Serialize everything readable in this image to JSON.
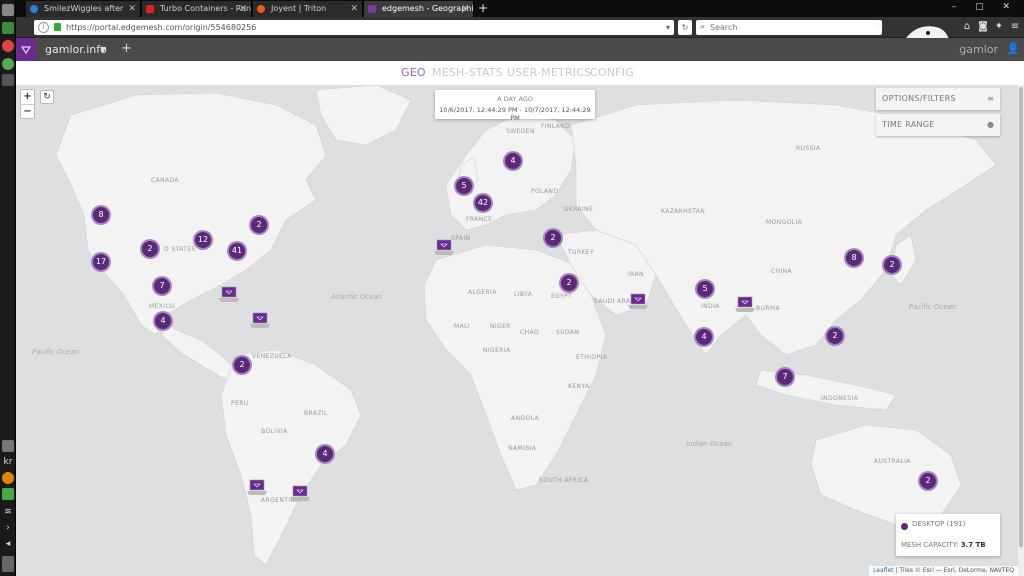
{
  "browser": {
    "tabs": [
      {
        "title": "SmilezWiggles after",
        "active": false
      },
      {
        "title": "Turbo Containers - Run A",
        "active": false
      },
      {
        "title": "Joyent | Triton",
        "active": false
      },
      {
        "title": "edgemesh - Geographic",
        "active": true
      }
    ],
    "new_tab": "+",
    "url": "https://portal.edgemesh.com/origin/554680256",
    "search_placeholder": "Search"
  },
  "app": {
    "name": "gamlor.info",
    "user": "gamlor",
    "tabs": [
      {
        "label": "GEO",
        "active": true
      },
      {
        "label": "MESH-STATS",
        "active": false
      },
      {
        "label": "USER-METRICS",
        "active": false
      },
      {
        "label": "CONFIG",
        "active": false
      }
    ]
  },
  "map": {
    "zoom_in": "+",
    "zoom_out": "−",
    "time": {
      "title": "A DAY AGO",
      "range": "10/6/2017, 12:44:29 PM - 10/7/2017, 12:44:29 PM"
    },
    "panels": {
      "options": "OPTIONS/FILTERS",
      "time_range": "TIME RANGE"
    },
    "clusters": [
      "8",
      "2",
      "12",
      "2",
      "41",
      "17",
      "7",
      "4",
      "2",
      "4",
      "5",
      "42",
      "4",
      "2",
      "2",
      "5",
      "4",
      "8",
      "2",
      "2",
      "7",
      "2"
    ],
    "labels": {
      "canada": "CANADA",
      "states": "D STATES",
      "mexico": "MEXICO",
      "venezuela": "VENEZUELA",
      "peru": "PERU",
      "brazil": "BRAZIL",
      "bolivia": "BOLIVIA",
      "argentina": "ARGENTINA",
      "sweden": "SWEDEN",
      "finland": "FINLAND",
      "poland": "POLAND",
      "ukraine": "UKRAINE",
      "france": "FRANCE",
      "spain": "SPAIN",
      "turkey": "TURKEY",
      "algeria": "ALGERIA",
      "libya": "LIBYA",
      "egypt": "EGYPT",
      "mali": "MALI",
      "niger": "NIGER",
      "chad": "CHAD",
      "sudan": "SUDAN",
      "nigeria": "NIGERIA",
      "ethiopia": "ETHIOPIA",
      "kenya": "KENYA",
      "angola": "ANGOLA",
      "namibia": "NAMIBIA",
      "south_africa": "SOUTH AFRICA",
      "saudi": "SAUDI ARABIA",
      "iran": "IRAN",
      "india": "INDIA",
      "russia": "RUSSIA",
      "kazakhstan": "KAZAKHSTAN",
      "mongolia": "MONGOLIA",
      "china": "CHINA",
      "myanmar": "BURMA",
      "indonesia": "INDONESIA",
      "australia": "AUSTRALIA",
      "pacific_w": "Pacific Ocean",
      "pacific_e": "Pacific Ocean",
      "atlantic": "Atlantic Ocean",
      "indian": "Indian Ocean"
    },
    "legend": {
      "desktop": "DESKTOP (191)",
      "capacity_label": "MESH CAPACITY:",
      "capacity_value": "3.7 TB"
    },
    "attribution": {
      "leaflet": "Leaflet",
      "tiles": "| Tiles © Esri — Esri, DeLorme, NAVTEQ"
    }
  },
  "colors": {
    "accent": "#9466b5",
    "cluster": "#5a2a78",
    "land": "#f2f2f2",
    "water": "#dedfe0"
  }
}
